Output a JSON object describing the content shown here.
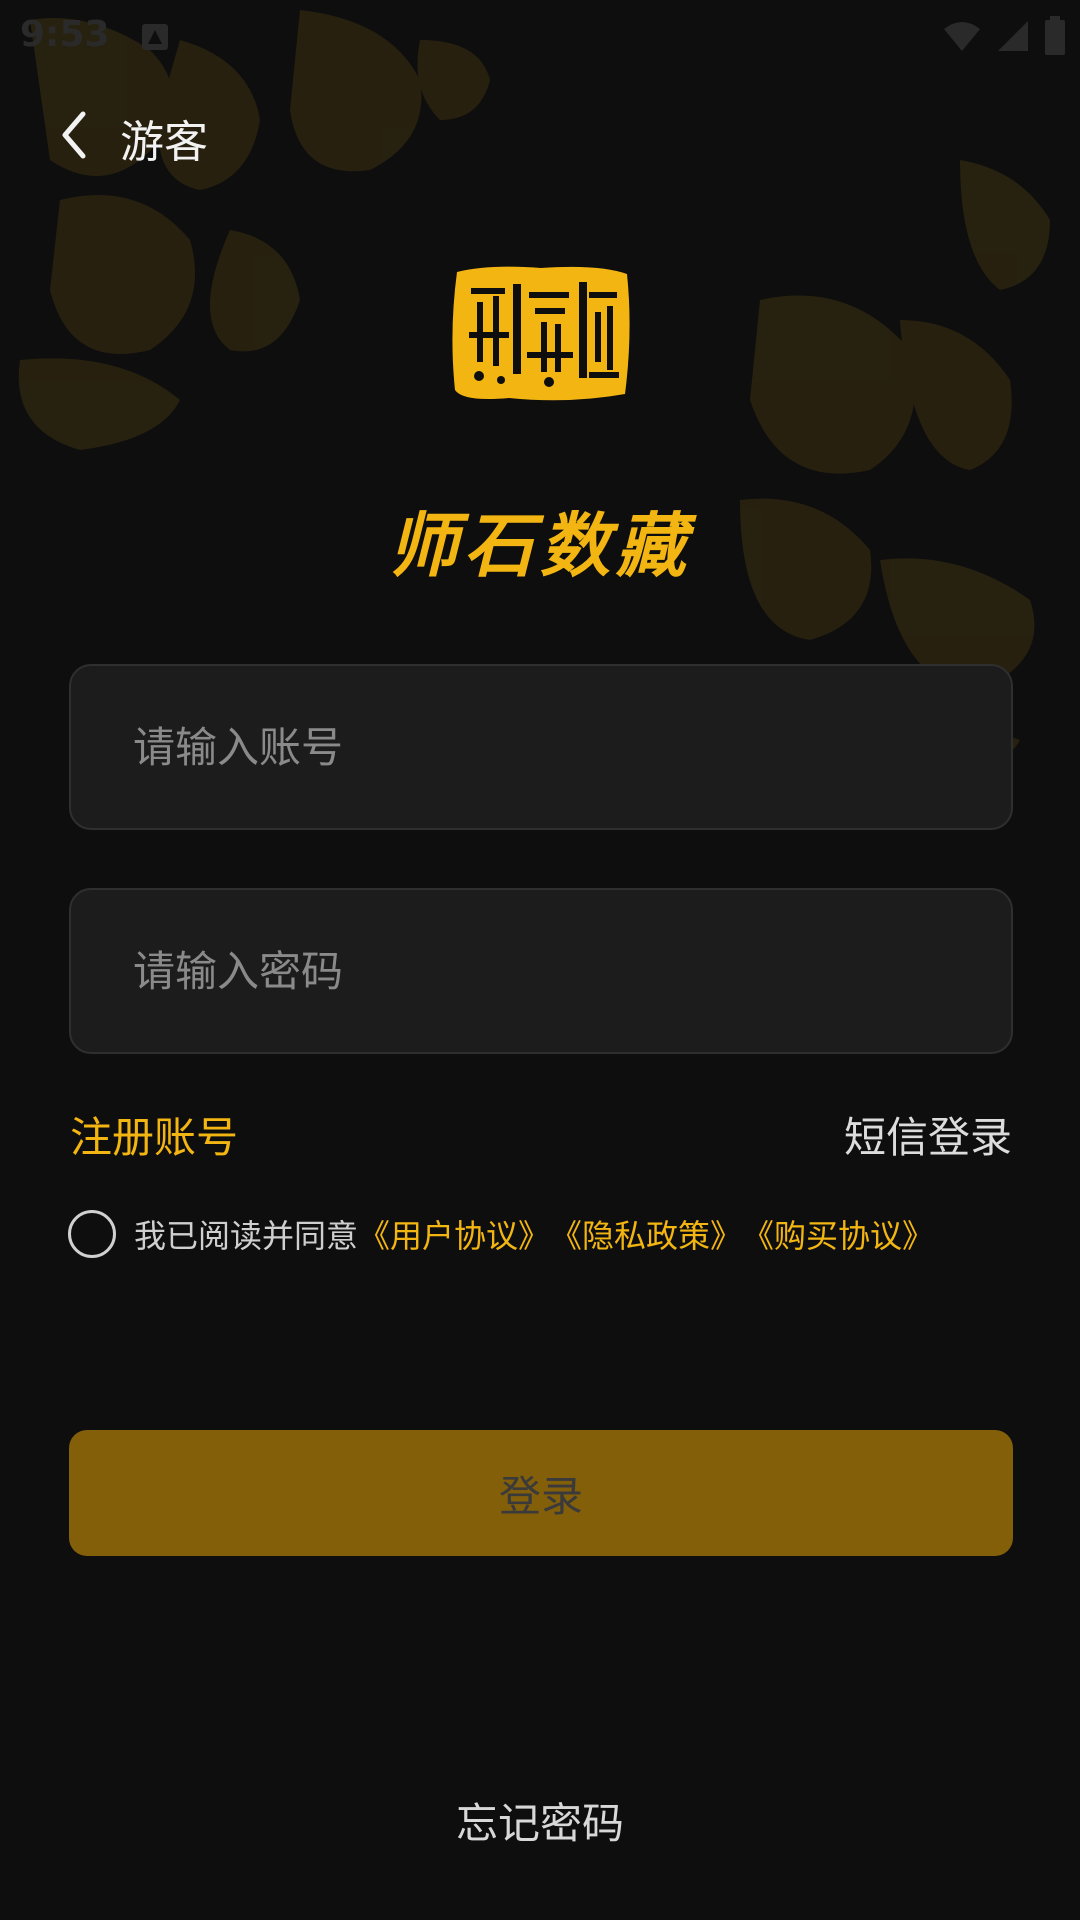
{
  "status_bar": {
    "time": "9:53",
    "icons": [
      "notification-icon",
      "wifi-icon",
      "signal-icon",
      "battery-icon"
    ]
  },
  "header": {
    "back_icon": "chevron-left-icon",
    "title": "游客"
  },
  "brand": {
    "name": "师石数藏",
    "accent_color": "#f3b512"
  },
  "form": {
    "account_placeholder": "请输入账号",
    "account_value": "",
    "password_placeholder": "请输入密码",
    "password_value": ""
  },
  "links": {
    "register": "注册账号",
    "sms_login": "短信登录"
  },
  "agreement": {
    "checked": false,
    "prefix": "我已阅读并同意",
    "user_agreement": "《用户协议》",
    "privacy_policy": "《隐私政策》",
    "purchase_agreement": "《购买协议》"
  },
  "login_button": {
    "label": "登录",
    "color": "#845f0a"
  },
  "forgot_password": "忘记密码"
}
